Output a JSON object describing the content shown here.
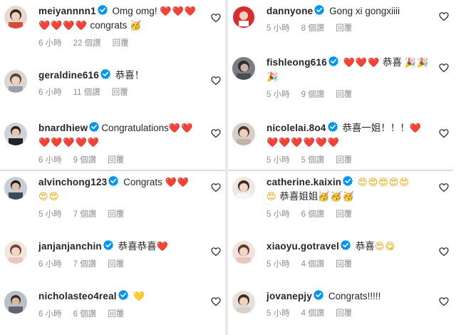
{
  "left": [
    {
      "username": "meiyannnn1",
      "text": "Omg omg!",
      "emoji_line1": "❤️❤️❤️",
      "line2_emoji": "❤️❤️❤️❤️",
      "line2_text": "congrats",
      "line2_emoji_after": "🥳",
      "time": "6 小時",
      "likes": "22 個讚",
      "reply": "回覆"
    },
    {
      "username": "geraldine616",
      "text": "恭喜！",
      "time": "6 小時",
      "likes": "11 個讚",
      "reply": "回覆"
    },
    {
      "username": "bnardhiew",
      "text": "Congratulations",
      "emoji_line1": "❤️❤️",
      "line2_emoji": "❤️❤️❤️❤️❤️",
      "time": "6 小時",
      "likes": "9 個讚",
      "reply": "回覆"
    },
    {
      "username": "alvinchong123",
      "text": "Congrats",
      "emoji_line1": "❤️❤️",
      "line2_emoji": "😍😍",
      "time": "5 小時",
      "likes": "7 個讚",
      "reply": "回覆"
    },
    {
      "username": "janjanjanchin",
      "text": "恭喜恭喜",
      "emoji_line1": "❤️",
      "time": "6 小時",
      "likes": "7 個讚",
      "reply": "回覆"
    },
    {
      "username": "nicholasteo4real",
      "text": "",
      "emoji_line1": "💛",
      "time": "6 小時",
      "likes": "6 個讚",
      "reply": "回覆"
    }
  ],
  "right": [
    {
      "username": "dannyone",
      "text": "Gong xi gongxiiii",
      "time": "5 小時",
      "likes": "8 個讚",
      "reply": "回覆"
    },
    {
      "username": "fishleong616",
      "text": "",
      "emoji_line1": "❤️❤️❤️",
      "text_after": "恭喜",
      "emoji_after": "🎉🎉",
      "line2_emoji": "🎉",
      "time": "5 小時",
      "likes": "9 個讚",
      "reply": "回覆"
    },
    {
      "username": "nicolelai.8o4",
      "text": "恭喜一姐！！！",
      "emoji_line1": "❤️",
      "line2_emoji": "❤️❤️❤️❤️❤️❤️",
      "time": "5 小時",
      "likes": "5 個讚",
      "reply": "回覆"
    },
    {
      "username": "catherine.kaixin",
      "text": "",
      "emoji_line1": "😍😍😍😍😍",
      "line2_emoji": "😍",
      "line2_text": "恭喜姐姐",
      "line2_emoji_after": "🥳🥳🥳",
      "time": "5 小時",
      "likes": "6 個讚",
      "reply": "回覆"
    },
    {
      "username": "xiaoyu.gotravel",
      "text": "恭喜",
      "emoji_line1": "😍😋",
      "time": "5 小時",
      "likes": "4 個讚",
      "reply": "回覆"
    },
    {
      "username": "jovanepjy",
      "text": "Congrats!!!!!",
      "time": "5 小時",
      "likes": "4 個讚",
      "reply": "回覆"
    }
  ],
  "colors": {
    "heart": "#ed1c24",
    "verified": "#0095f6",
    "meta": "#8e8e8e",
    "divider": "#e9e9e9"
  }
}
